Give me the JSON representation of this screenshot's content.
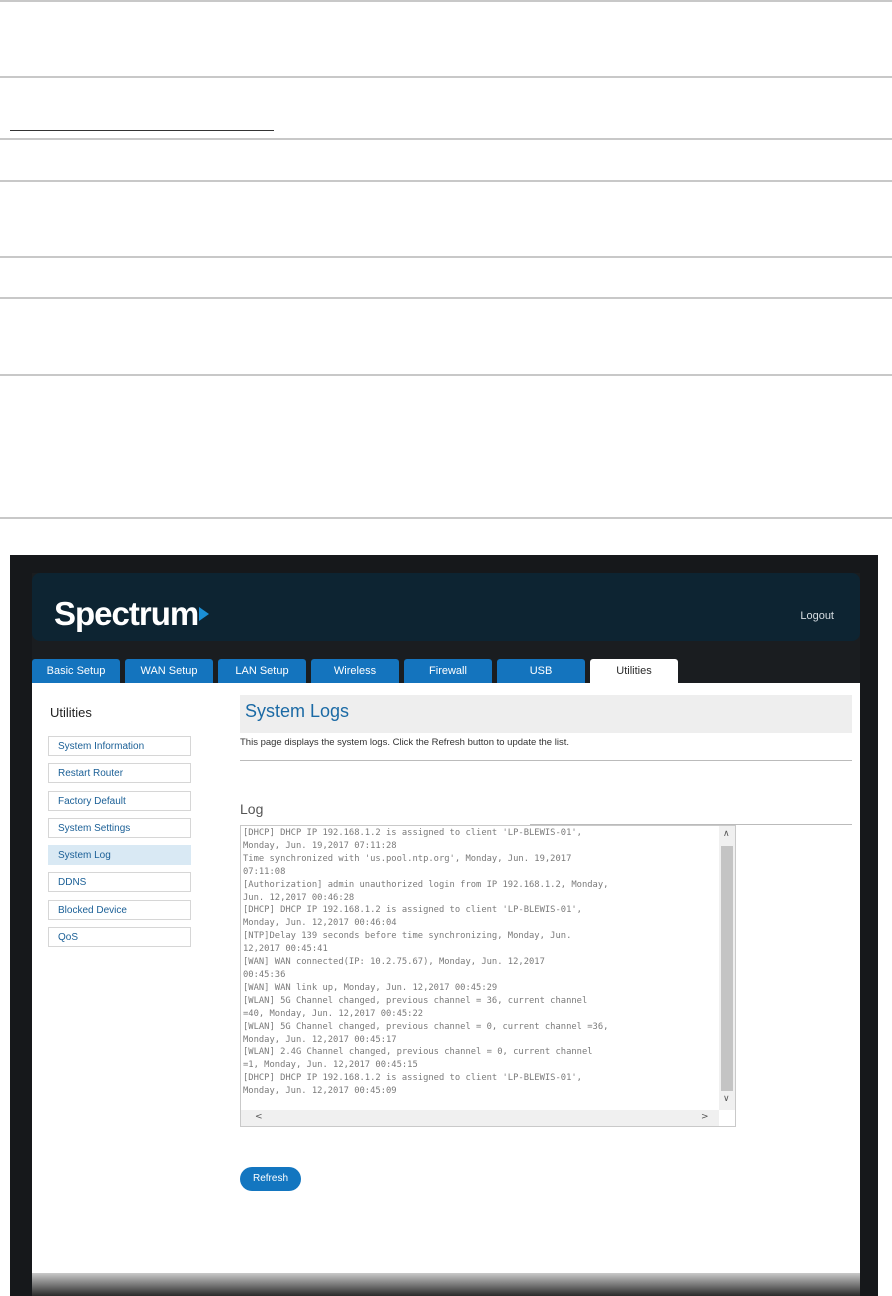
{
  "app": {
    "logo_text": "Spectrum",
    "logout_label": "Logout"
  },
  "tabs": [
    {
      "label": "Basic Setup"
    },
    {
      "label": "WAN Setup"
    },
    {
      "label": "LAN Setup"
    },
    {
      "label": "Wireless"
    },
    {
      "label": "Firewall"
    },
    {
      "label": "USB"
    },
    {
      "label": "Utilities",
      "active": true
    }
  ],
  "sidebar": {
    "title": "Utilities",
    "items": [
      {
        "label": "System Information"
      },
      {
        "label": "Restart Router"
      },
      {
        "label": "Factory Default"
      },
      {
        "label": "System Settings"
      },
      {
        "label": "System Log",
        "active": true
      },
      {
        "label": "DDNS"
      },
      {
        "label": "Blocked Device"
      },
      {
        "label": "QoS"
      }
    ]
  },
  "main": {
    "title": "System Logs",
    "description": "This page displays the system logs. Click the Refresh button to update the list.",
    "log_label": "Log",
    "log_lines": [
      "[DHCP] DHCP IP 192.168.1.2 is assigned to client 'LP-BLEWIS-01',",
      "Monday, Jun. 19,2017 07:11:28",
      "Time synchronized with 'us.pool.ntp.org', Monday, Jun. 19,2017",
      "07:11:08",
      "[Authorization] admin unauthorized login from IP 192.168.1.2, Monday,",
      "Jun. 12,2017 00:46:28",
      "[DHCP] DHCP IP 192.168.1.2 is assigned to client 'LP-BLEWIS-01',",
      "Monday, Jun. 12,2017 00:46:04",
      "[NTP]Delay 139 seconds before time synchronizing, Monday, Jun.",
      "12,2017 00:45:41",
      "[WAN] WAN connected(IP: 10.2.75.67), Monday, Jun. 12,2017",
      "00:45:36",
      "[WAN] WAN link up, Monday, Jun. 12,2017 00:45:29",
      "[WLAN] 5G Channel changed, previous channel = 36, current channel",
      "=40, Monday, Jun. 12,2017 00:45:22",
      "[WLAN] 5G Channel changed, previous channel = 0, current channel =36,",
      "Monday, Jun. 12,2017 00:45:17",
      "[WLAN] 2.4G Channel changed, previous channel = 0, current channel",
      "=1, Monday, Jun. 12,2017 00:45:15",
      "[DHCP] DHCP IP 192.168.1.2 is assigned to client 'LP-BLEWIS-01',",
      "Monday, Jun. 12,2017 00:45:09"
    ],
    "refresh_label": "Refresh"
  },
  "colors": {
    "header_bg": "#0d2432",
    "tab_blue": "#1474be",
    "link_blue": "#1a5f96",
    "title_blue": "#1b6aa5",
    "active_side_bg": "#d9e9f4"
  },
  "icons": {
    "scroll_up": "chevron-up-icon",
    "scroll_down": "chevron-down-icon",
    "scroll_left": "chevron-left-icon",
    "scroll_right": "chevron-right-icon",
    "logo_mark": "play-arrow-icon"
  }
}
